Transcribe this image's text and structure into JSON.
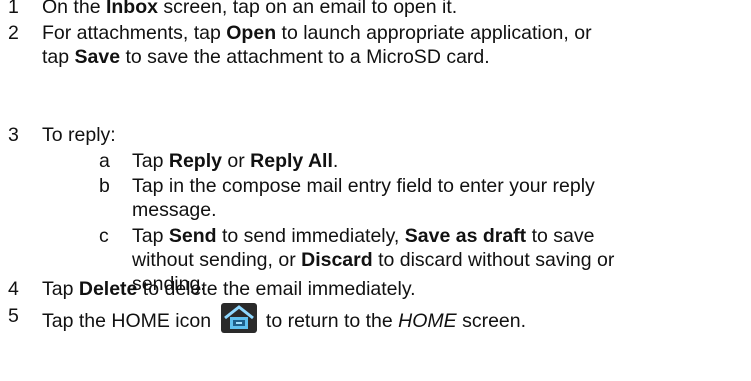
{
  "steps": [
    {
      "number": "1",
      "lines": [
        [
          {
            "t": "On the "
          },
          {
            "b": "Inbox"
          },
          {
            "t": " screen, tap on an email to open it."
          }
        ]
      ]
    },
    {
      "number": "2",
      "lines": [
        [
          {
            "t": "For attachments, tap "
          },
          {
            "b": "Open"
          },
          {
            "t": " to launch appropriate application, or"
          }
        ],
        [
          {
            "t": "tap "
          },
          {
            "b": "Save"
          },
          {
            "t": " to save the attachment to a MicroSD card."
          }
        ]
      ]
    },
    {
      "number": "3",
      "lines": [
        [
          {
            "t": "To reply:"
          }
        ]
      ],
      "substeps": [
        {
          "letter": "a",
          "lines": [
            [
              {
                "t": "Tap "
              },
              {
                "b": "Reply"
              },
              {
                "t": " or "
              },
              {
                "b": "Reply All"
              },
              {
                "t": "."
              }
            ]
          ]
        },
        {
          "letter": "b",
          "lines": [
            [
              {
                "t": "Tap in the compose mail entry field to enter your reply"
              }
            ],
            [
              {
                "t": "message."
              }
            ]
          ]
        },
        {
          "letter": "c",
          "lines": [
            [
              {
                "t": "Tap "
              },
              {
                "b": "Send"
              },
              {
                "t": " to send immediately, "
              },
              {
                "b": "Save as draft"
              },
              {
                "t": " to save"
              }
            ],
            [
              {
                "t": "without sending, or "
              },
              {
                "b": "Discard"
              },
              {
                "t": " to discard without saving or"
              }
            ],
            [
              {
                "t": "sending."
              }
            ]
          ]
        }
      ]
    },
    {
      "number": "4",
      "lines": [
        [
          {
            "t": "Tap "
          },
          {
            "b": "Delete"
          },
          {
            "t": " to delete the email immediately."
          }
        ]
      ]
    },
    {
      "number": "5",
      "lines": [
        [
          {
            "t": "Tap the HOME icon "
          },
          {
            "icon": "home-icon"
          },
          {
            "t": " to return to the "
          },
          {
            "i": "HOME"
          },
          {
            "t": " screen."
          }
        ]
      ]
    }
  ]
}
